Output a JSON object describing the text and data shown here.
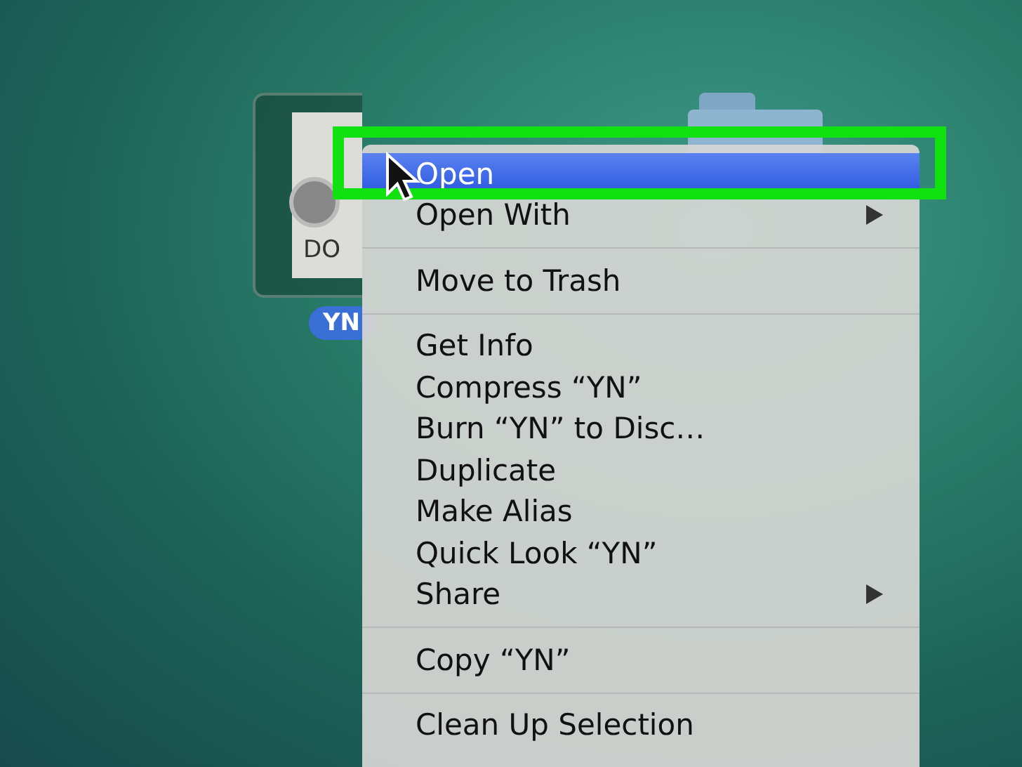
{
  "desktop_icons": [
    {
      "kind": "document",
      "icon_text": "DO",
      "label": "YN",
      "selected": true
    },
    {
      "kind": "folder",
      "selected": false
    }
  ],
  "context_menu": {
    "items": [
      {
        "kind": "item",
        "label": "Open",
        "selected": true,
        "submenu": false
      },
      {
        "kind": "item",
        "label": "Open With",
        "selected": false,
        "submenu": true
      },
      {
        "kind": "separator"
      },
      {
        "kind": "item",
        "label": "Move to Trash",
        "selected": false,
        "submenu": false
      },
      {
        "kind": "separator"
      },
      {
        "kind": "item",
        "label": "Get Info",
        "selected": false,
        "submenu": false
      },
      {
        "kind": "item",
        "label": "Compress “YN”",
        "selected": false,
        "submenu": false
      },
      {
        "kind": "item",
        "label": "Burn “YN” to Disc…",
        "selected": false,
        "submenu": false
      },
      {
        "kind": "item",
        "label": "Duplicate",
        "selected": false,
        "submenu": false
      },
      {
        "kind": "item",
        "label": "Make Alias",
        "selected": false,
        "submenu": false
      },
      {
        "kind": "item",
        "label": "Quick Look “YN”",
        "selected": false,
        "submenu": false
      },
      {
        "kind": "item",
        "label": "Share",
        "selected": false,
        "submenu": true
      },
      {
        "kind": "separator"
      },
      {
        "kind": "item",
        "label": "Copy “YN”",
        "selected": false,
        "submenu": false
      },
      {
        "kind": "separator"
      },
      {
        "kind": "item",
        "label": "Clean Up Selection",
        "selected": false,
        "submenu": false
      }
    ]
  }
}
